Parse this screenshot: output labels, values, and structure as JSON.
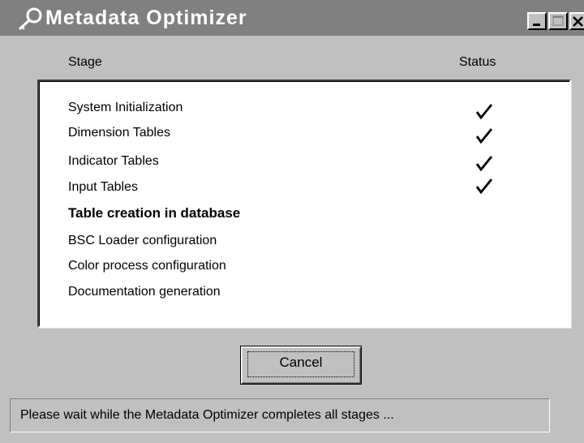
{
  "window": {
    "title": "Metadata Optimizer",
    "icon": "magnifier-key-icon",
    "controls": [
      "minimize-icon",
      "maximize-icon",
      "close-icon"
    ]
  },
  "columns": {
    "stage": "Stage",
    "status": "Status"
  },
  "stages": [
    {
      "label": "System Initialization",
      "done": true,
      "current": false
    },
    {
      "label": "Dimension Tables",
      "done": true,
      "current": false
    },
    {
      "label": "Indicator Tables",
      "done": true,
      "current": false
    },
    {
      "label": "Input Tables",
      "done": true,
      "current": false
    },
    {
      "label": "Table creation in database",
      "done": false,
      "current": true
    },
    {
      "label": "BSC Loader configuration",
      "done": false,
      "current": false
    },
    {
      "label": "Color process configuration",
      "done": false,
      "current": false
    },
    {
      "label": "Documentation generation",
      "done": false,
      "current": false
    }
  ],
  "cancel_button": {
    "label": "Cancel"
  },
  "statusbar": {
    "text": "Please wait while the Metadata Optimizer completes all stages ..."
  },
  "colors": {
    "face": "#c0c0c0",
    "titlebar_inactive": "#808080",
    "panel": "#ffffff"
  }
}
